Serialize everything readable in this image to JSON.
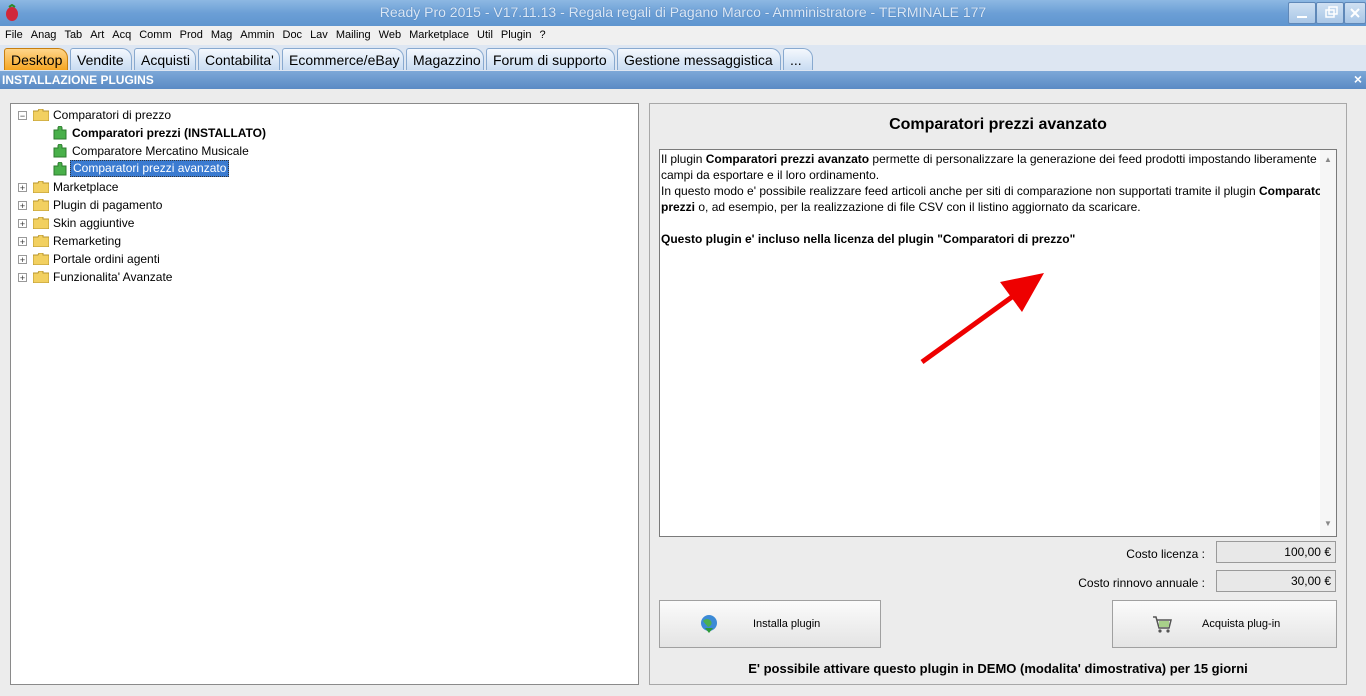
{
  "window": {
    "title": "Ready Pro 2015 - V17.11.13 - Regala regali di Pagano Marco - Amministratore - TERMINALE 177"
  },
  "menu": [
    "File",
    "Anag",
    "Tab",
    "Art",
    "Acq",
    "Comm",
    "Prod",
    "Mag",
    "Ammin",
    "Doc",
    "Lav",
    "Mailing",
    "Web",
    "Marketplace",
    "Util",
    "Plugin",
    "?"
  ],
  "tabs": [
    "Desktop",
    "Vendite",
    "Acquisti",
    "Contabilita'",
    "Ecommerce/eBay",
    "Magazzino",
    "Forum di supporto",
    "Gestione messaggistica",
    "..."
  ],
  "section": {
    "title": "INSTALLAZIONE PLUGINS",
    "close": "×"
  },
  "tree": {
    "root": "Comparatori di prezzo",
    "children": [
      "Comparatori prezzi (INSTALLATO)",
      "Comparatore Mercatino Musicale",
      "Comparatori prezzi avanzato"
    ],
    "others": [
      "Marketplace",
      "Plugin di pagamento",
      "Skin aggiuntive",
      "Remarketing",
      "Portale ordini agenti",
      "Funzionalita' Avanzate"
    ]
  },
  "detail": {
    "title": "Comparatori prezzi avanzato",
    "p1a": "Il plugin ",
    "p1b": "Comparatori prezzi avanzato",
    "p1c": " permette di personalizzare la generazione dei feed prodotti impostando liberamente i campi da esportare e il loro ordinamento.",
    "p2a": "In questo modo e' possibile realizzare feed articoli anche per siti di comparazione non supportati tramite il plugin ",
    "p2b": "Comparatori prezzi",
    "p2c": " o, ad esempio, per la realizzazione di file CSV con il listino aggiornato da scaricare.",
    "p3": "Questo plugin e' incluso nella licenza del plugin \"Comparatori di prezzo\"",
    "license_label": "Costo licenza :",
    "license_value": "100,00 €",
    "renewal_label": "Costo rinnovo annuale :",
    "renewal_value": "30,00 €",
    "install_label": "Installa plugin",
    "buy_label": "Acquista plug-in",
    "demo_note": "E' possibile attivare questo plugin in DEMO (modalita' dimostrativa) per 15 giorni"
  },
  "colors": {
    "accent": "#f5a623",
    "titlebar": "#6c9fd6",
    "arrow": "#ee0000"
  }
}
